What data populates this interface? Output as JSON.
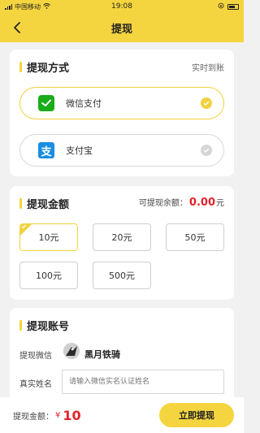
{
  "status_bar": {
    "carrier": "中国移动",
    "time": "19:08"
  },
  "header": {
    "title": "提现"
  },
  "withdraw_method": {
    "title": "提现方式",
    "hint": "实时到账",
    "options": [
      {
        "label": "微信支付",
        "icon": "wechat-pay-icon",
        "selected": true
      },
      {
        "label": "支付宝",
        "icon": "alipay-icon",
        "selected": false
      }
    ]
  },
  "withdraw_amount": {
    "title": "提现金额",
    "balance_label": "可提现余额：",
    "balance_value": "0.00",
    "balance_unit": "元",
    "amounts": [
      "10元",
      "20元",
      "50元",
      "100元",
      "500元"
    ],
    "selected_index": 0
  },
  "withdraw_account": {
    "title": "提现账号",
    "wechat_label": "提现微信",
    "wechat_nickname": "黑月铁骑",
    "name_label": "真实姓名",
    "name_placeholder": "请输入微信实名认证姓名"
  },
  "bottom": {
    "amount_label": "提现金额：",
    "currency": "¥",
    "amount_value": "10",
    "submit_label": "立即提现"
  },
  "colors": {
    "accent": "#f5d53f",
    "price_red": "#e2242a",
    "wechat_green": "#1aad19",
    "alipay_blue": "#1a8ee0"
  }
}
